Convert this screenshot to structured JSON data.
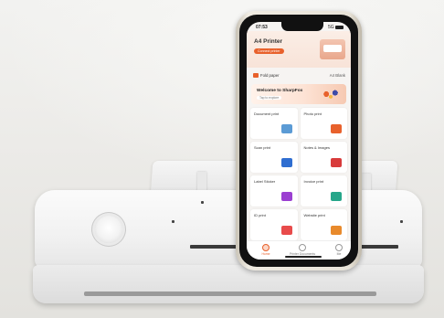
{
  "scene": {
    "status_bar": {
      "time": "07:53",
      "signal": "5G"
    },
    "app": {
      "printer_title": "A4 Printer",
      "connect_label": "Connect printer",
      "paper": {
        "label": "Fold paper",
        "check": "A4 Blank"
      },
      "banner": {
        "title": "Welcome to SharpFox",
        "subtitle": "Tap to explore"
      },
      "features": [
        {
          "label": "Document print",
          "art_color": "#5b9bd5"
        },
        {
          "label": "Photo print",
          "art_color": "#e8612c"
        },
        {
          "label": "Scan print",
          "art_color": "#2f6ed1"
        },
        {
          "label": "Notes & Images",
          "art_color": "#d83b3b"
        },
        {
          "label": "Label Sticker",
          "art_color": "#9b3fd1"
        },
        {
          "label": "Invoice print",
          "art_color": "#26a68a"
        },
        {
          "label": "ID print",
          "art_color": "#e84b4b"
        },
        {
          "label": "Website print",
          "art_color": "#e88a2c"
        }
      ],
      "tabs": [
        {
          "label": "Home",
          "active": true
        },
        {
          "label": "Printer Documents",
          "active": false
        },
        {
          "label": "Me",
          "active": false
        }
      ]
    },
    "colors": {
      "accent": "#e8612c",
      "printer_body": "#f1f1f1"
    }
  }
}
